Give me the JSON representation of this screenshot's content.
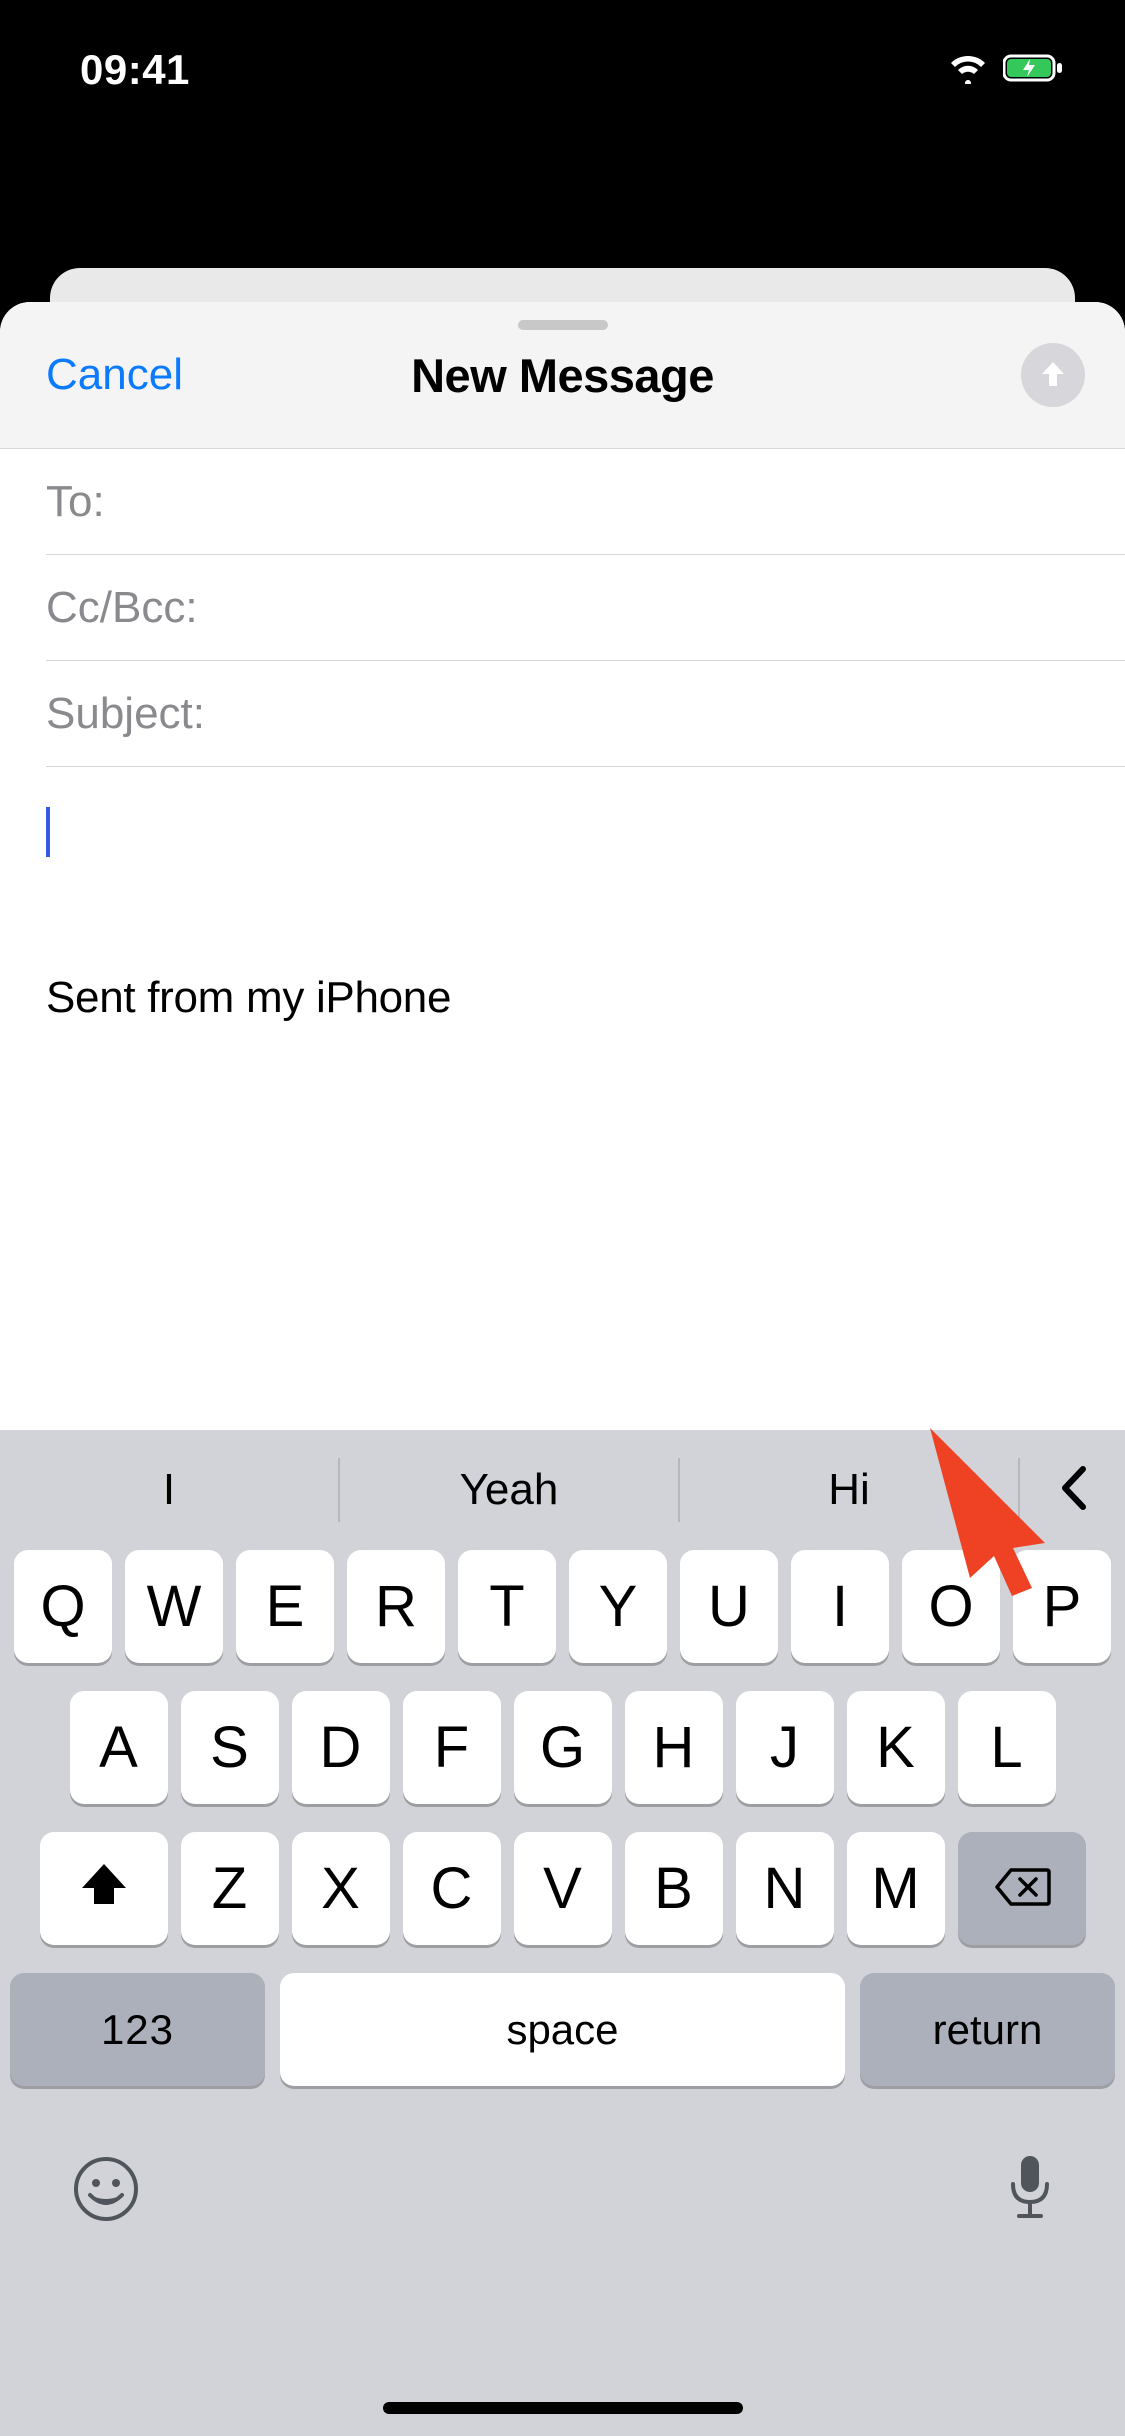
{
  "status": {
    "time": "09:41"
  },
  "header": {
    "cancel": "Cancel",
    "title": "New Message"
  },
  "fields": {
    "to_label": "To:",
    "ccbcc_label": "Cc/Bcc:",
    "subject_label": "Subject:"
  },
  "body": {
    "signature": "Sent from my iPhone"
  },
  "predictions": {
    "p1": "I",
    "p2": "Yeah",
    "p3": "Hi"
  },
  "keyboard": {
    "row1": [
      "Q",
      "W",
      "E",
      "R",
      "T",
      "Y",
      "U",
      "I",
      "O",
      "P"
    ],
    "row2": [
      "A",
      "S",
      "D",
      "F",
      "G",
      "H",
      "J",
      "K",
      "L"
    ],
    "row3": [
      "Z",
      "X",
      "C",
      "V",
      "B",
      "N",
      "M"
    ],
    "numeric": "123",
    "space": "space",
    "return": "return"
  }
}
